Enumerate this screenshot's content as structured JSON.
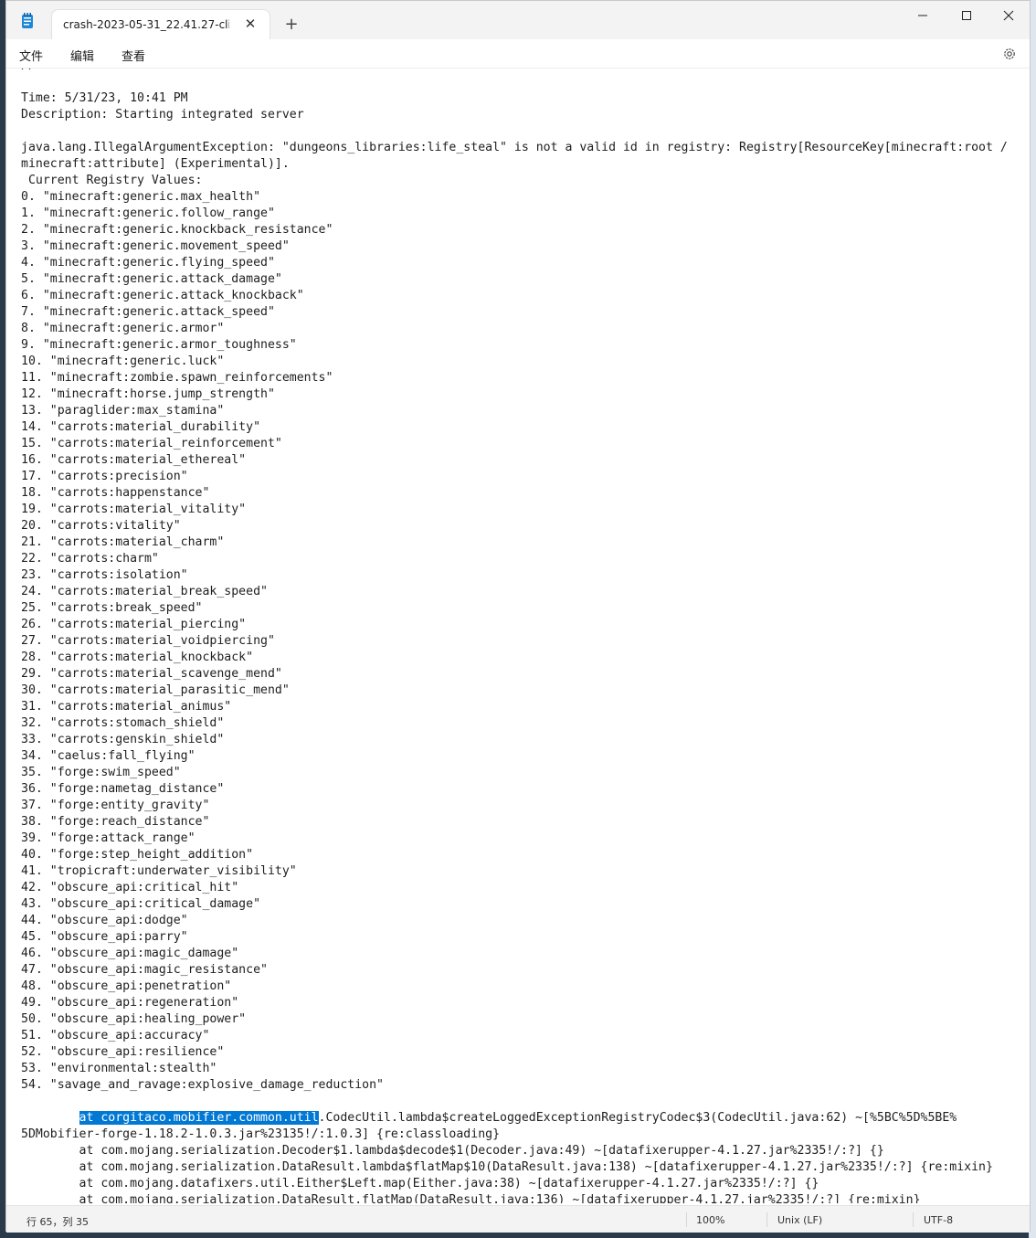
{
  "window": {
    "tab_title": "crash-2023-05-31_22.41.27-client.txt",
    "tab_close": "✕",
    "new_tab": "+"
  },
  "menu": {
    "file": "文件",
    "edit": "编辑",
    "view": "查看"
  },
  "editor": {
    "header_lines": [
      "// ...",
      "",
      "Time: 5/31/23, 10:41 PM",
      "Description: Starting integrated server",
      ""
    ],
    "exception_lines": [
      "java.lang.IllegalArgumentException: \"dungeons_libraries:life_steal\" is not a valid id in registry: Registry[ResourceKey[minecraft:root /",
      "minecraft:attribute] (Experimental)].",
      " Current Registry Values:"
    ],
    "registry_values": [
      "0. \"minecraft:generic.max_health\"",
      "1. \"minecraft:generic.follow_range\"",
      "2. \"minecraft:generic.knockback_resistance\"",
      "3. \"minecraft:generic.movement_speed\"",
      "4. \"minecraft:generic.flying_speed\"",
      "5. \"minecraft:generic.attack_damage\"",
      "6. \"minecraft:generic.attack_knockback\"",
      "7. \"minecraft:generic.attack_speed\"",
      "8. \"minecraft:generic.armor\"",
      "9. \"minecraft:generic.armor_toughness\"",
      "10. \"minecraft:generic.luck\"",
      "11. \"minecraft:zombie.spawn_reinforcements\"",
      "12. \"minecraft:horse.jump_strength\"",
      "13. \"paraglider:max_stamina\"",
      "14. \"carrots:material_durability\"",
      "15. \"carrots:material_reinforcement\"",
      "16. \"carrots:material_ethereal\"",
      "17. \"carrots:precision\"",
      "18. \"carrots:happenstance\"",
      "19. \"carrots:material_vitality\"",
      "20. \"carrots:vitality\"",
      "21. \"carrots:material_charm\"",
      "22. \"carrots:charm\"",
      "23. \"carrots:isolation\"",
      "24. \"carrots:material_break_speed\"",
      "25. \"carrots:break_speed\"",
      "26. \"carrots:material_piercing\"",
      "27. \"carrots:material_voidpiercing\"",
      "28. \"carrots:material_knockback\"",
      "29. \"carrots:material_scavenge_mend\"",
      "30. \"carrots:material_parasitic_mend\"",
      "31. \"carrots:material_animus\"",
      "32. \"carrots:stomach_shield\"",
      "33. \"carrots:genskin_shield\"",
      "34. \"caelus:fall_flying\"",
      "35. \"forge:swim_speed\"",
      "36. \"forge:nametag_distance\"",
      "37. \"forge:entity_gravity\"",
      "38. \"forge:reach_distance\"",
      "39. \"forge:attack_range\"",
      "40. \"forge:step_height_addition\"",
      "41. \"tropicraft:underwater_visibility\"",
      "42. \"obscure_api:critical_hit\"",
      "43. \"obscure_api:critical_damage\"",
      "44. \"obscure_api:dodge\"",
      "45. \"obscure_api:parry\"",
      "46. \"obscure_api:magic_damage\"",
      "47. \"obscure_api:magic_resistance\"",
      "48. \"obscure_api:penetration\"",
      "49. \"obscure_api:regeneration\"",
      "50. \"obscure_api:healing_power\"",
      "51. \"obscure_api:accuracy\"",
      "52. \"obscure_api:resilience\"",
      "53. \"environmental:stealth\"",
      "54. \"savage_and_ravage:explosive_damage_reduction\""
    ],
    "stack_first_indent": "        ",
    "stack_first_selected": "at corgitaco.mobifier.common.util",
    "stack_first_rest": ".CodecUtil.lambda$createLoggedExceptionRegistryCodec$3(CodecUtil.java:62) ~[%5BC%5D%5BE%",
    "stack_lines": [
      "5DMobifier-forge-1.18.2-1.0.3.jar%23135!/:1.0.3] {re:classloading}",
      "        at com.mojang.serialization.Decoder$1.lambda$decode$1(Decoder.java:49) ~[datafixerupper-4.1.27.jar%2335!/:?] {}",
      "        at com.mojang.serialization.DataResult.lambda$flatMap$10(DataResult.java:138) ~[datafixerupper-4.1.27.jar%2335!/:?] {re:mixin}",
      "        at com.mojang.datafixers.util.Either$Left.map(Either.java:38) ~[datafixerupper-4.1.27.jar%2335!/:?] {}",
      "        at com.mojang.serialization.DataResult.flatMap(DataResult.java:136) ~[datafixerupper-4.1.27.jar%2335!/:?] {re:mixin}"
    ]
  },
  "status": {
    "position": "行 65，列 35",
    "zoom": "100%",
    "line_ending": "Unix (LF)",
    "encoding": "UTF-8"
  }
}
